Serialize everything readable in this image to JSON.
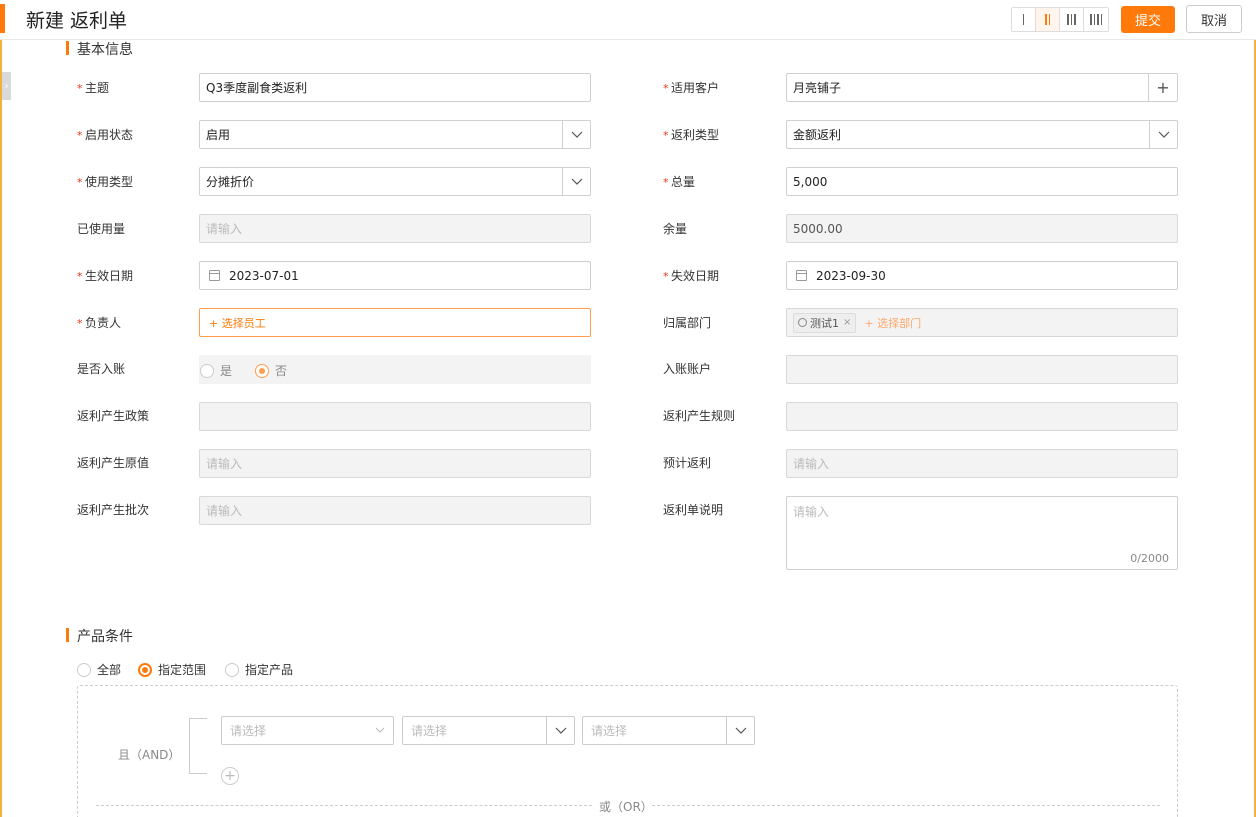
{
  "header": {
    "title": "新建 返利单",
    "submit_label": "提交",
    "cancel_label": "取消",
    "layout_options": [
      "1-column",
      "2-column",
      "3-column",
      "4-column"
    ],
    "layout_selected": "2-column"
  },
  "sections": {
    "basic_info": "基本信息",
    "product_conditions": "产品条件"
  },
  "form": {
    "subject": {
      "label": "主题",
      "value": "Q3季度副食类返利"
    },
    "customer": {
      "label": "适用客户",
      "value": "月亮铺子",
      "add": "+"
    },
    "status": {
      "label": "启用状态",
      "value": "启用"
    },
    "rebate_type": {
      "label": "返利类型",
      "value": "金额返利"
    },
    "usage_type": {
      "label": "使用类型",
      "value": "分摊折价"
    },
    "total": {
      "label": "总量",
      "value": "5,000"
    },
    "used": {
      "label": "已使用量",
      "placeholder": "请输入"
    },
    "remaining": {
      "label": "余量",
      "value": "5000.00"
    },
    "effective_date": {
      "label": "生效日期",
      "value": "2023-07-01"
    },
    "expiry_date": {
      "label": "失效日期",
      "value": "2023-09-30"
    },
    "owner": {
      "label": "负责人",
      "link": "+ 选择员工"
    },
    "department": {
      "label": "归属部门",
      "tag": "测试1",
      "tag_close": "×",
      "link": "+ 选择部门"
    },
    "posted": {
      "label": "是否入账",
      "yes": "是",
      "no": "否",
      "selected": "否"
    },
    "account": {
      "label": "入账账户"
    },
    "policy": {
      "label": "返利产生政策"
    },
    "rule": {
      "label": "返利产生规则"
    },
    "orig_value": {
      "label": "返利产生原值",
      "placeholder": "请输入"
    },
    "expected": {
      "label": "预计返利",
      "placeholder": "请输入"
    },
    "batch": {
      "label": "返利产生批次",
      "placeholder": "请输入"
    },
    "remark": {
      "label": "返利单说明",
      "placeholder": "请输入",
      "counter": "0/2000"
    }
  },
  "product_conditions": {
    "scope_options": [
      "全部",
      "指定范围",
      "指定产品"
    ],
    "scope_selected": "指定范围",
    "and_label": "且（AND）",
    "or_label": "或（OR）",
    "select_placeholder": "请选择",
    "add": "+"
  },
  "colors": {
    "accent": "#ff7a0a",
    "required": "#e8341a",
    "frame": "#f0b23c"
  }
}
